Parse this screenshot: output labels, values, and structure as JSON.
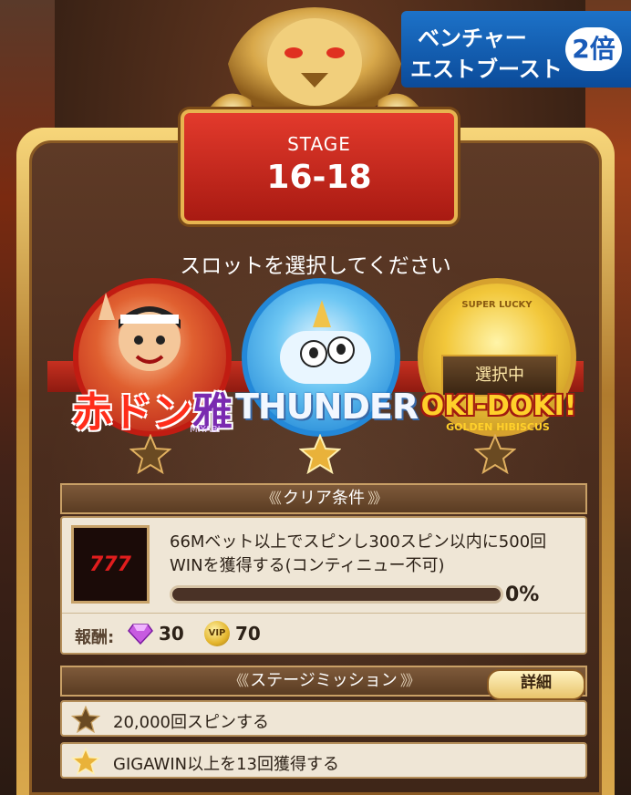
{
  "banner": {
    "line1": "ベンチャー",
    "line2": "エストブースト",
    "badge": "2倍"
  },
  "stage": {
    "label": "STAGE",
    "number": "16-18"
  },
  "prompt": "スロットを選択してください",
  "slots": [
    {
      "name_main": "赤ドン",
      "name_accent": "雅",
      "subtitle": "MIYABI",
      "selected": false
    },
    {
      "name_main": "THUNDER",
      "selected": false
    },
    {
      "name_main": "OKI-DOKI!",
      "subtitle": "GOLDEN HIBISCUS",
      "badge_top": "SUPER LUCKY",
      "selected": true,
      "selected_label": "選択中"
    }
  ],
  "clear_conditions": {
    "title": "クリア条件",
    "icon_label": "777",
    "description": "66Mベット以上でスピンし300スピン以内に500回WINを獲得する(コンティニュー不可)",
    "progress_percent": 0,
    "progress_label": "0%",
    "reward_label": "報酬:",
    "rewards": [
      {
        "icon": "gem-icon",
        "value": "30"
      },
      {
        "icon": "vip-coin-icon",
        "icon_text": "VIP",
        "value": "70"
      }
    ]
  },
  "stage_missions": {
    "title": "ステージミッション",
    "detail_button": "詳細",
    "items": [
      {
        "text": "20,000回スピンする",
        "achieved": false
      },
      {
        "text": "GIGAWIN以上を13回獲得する",
        "achieved": true
      }
    ]
  },
  "colors": {
    "frame_gold": "#d9a84c",
    "stage_red": "#c62a1e",
    "panel_bg": "#efe6d6",
    "star_gold": "#e9b23a",
    "star_dark": "#6a4a22"
  }
}
